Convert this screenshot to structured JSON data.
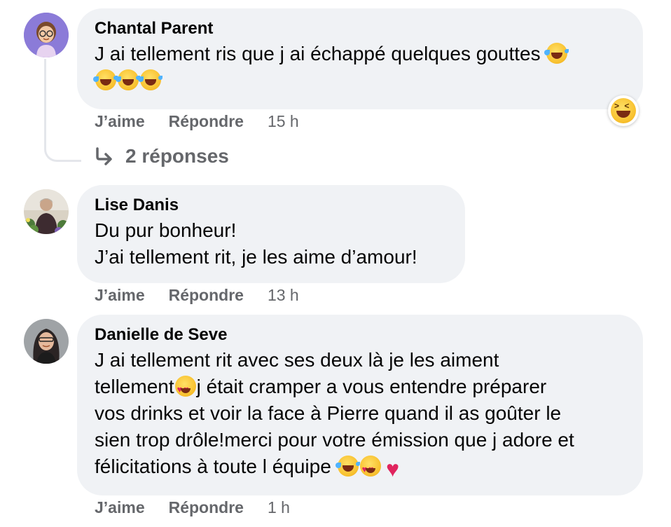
{
  "comments": [
    {
      "author": "Chantal Parent",
      "text_line1": "J ai tellement ris que j ai échappé quelques gouttes",
      "like_label": "J’aime",
      "reply_label": "Répondre",
      "time": "15 h",
      "replies_label": "2 réponses"
    },
    {
      "author": "Lise Danis",
      "text": "Du pur bonheur!\nJ’ai tellement rit, je les aime d’amour!",
      "like_label": "J’aime",
      "reply_label": "Répondre",
      "time": "13 h"
    },
    {
      "author": "Danielle de Seve",
      "text_part1": "J ai tellement rit avec ses deux là je les aiment\ntellement",
      "text_part2": "j était cramper a vous entendre préparer\nvos drinks et voir la face à Pierre quand il as goûter le\nsien trop drôle!merci pour votre émission que j adore et\nfélicitations à toute l équipe ",
      "like_label": "J’aime",
      "reply_label": "Répondre",
      "time": "1 h"
    }
  ],
  "icons": {
    "laugh": "rolling-on-floor-laughing-emoji",
    "hearteyes": "heart-eyes-emoji",
    "heart": "red-heart-emoji",
    "reaction": "haha-reaction-icon",
    "reply_arrow": "reply-arrow-icon"
  },
  "colors": {
    "bubble": "#f0f2f5",
    "secondary_text": "#65676b",
    "thread_line": "#e4e6eb"
  }
}
